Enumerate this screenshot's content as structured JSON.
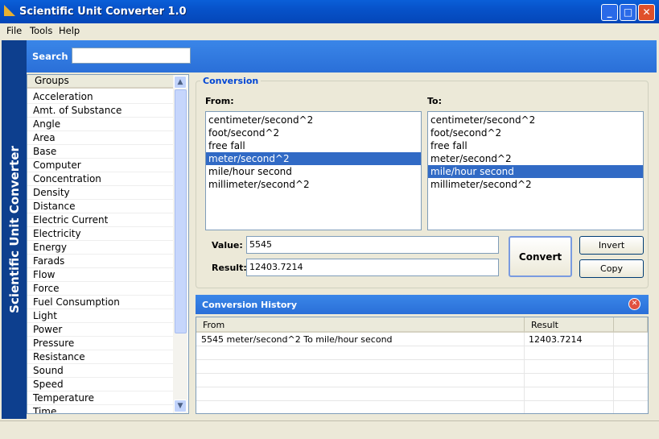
{
  "window": {
    "title": "Scientific Unit Converter 1.0",
    "controls": [
      "minimize",
      "maximize",
      "close"
    ]
  },
  "menu": [
    "File",
    "Tools",
    "Help"
  ],
  "sidebar_title": "Scientific Unit Converter",
  "search": {
    "label": "Search",
    "value": ""
  },
  "groups": {
    "header": "Groups",
    "items": [
      "Acceleration",
      "Amt. of Substance",
      "Angle",
      "Area",
      "Base",
      "Computer",
      "Concentration",
      "Density",
      "Distance",
      "Electric Current",
      "Electricity",
      "Energy",
      "Farads",
      "Flow",
      "Force",
      "Fuel Consumption",
      "Light",
      "Power",
      "Pressure",
      "Resistance",
      "Sound",
      "Speed",
      "Temperature",
      "Time"
    ]
  },
  "conversion": {
    "title": "Conversion",
    "from_label": "From:",
    "to_label": "To:",
    "units": [
      "centimeter/second^2",
      "foot/second^2",
      "free fall",
      "meter/second^2",
      "mile/hour second",
      "millimeter/second^2"
    ],
    "from_selected": "meter/second^2",
    "to_selected": "mile/hour second",
    "value_label": "Value:",
    "value": "5545",
    "result_label": "Result:",
    "result": "12403.7214",
    "convert": "Convert",
    "invert": "Invert",
    "copy": "Copy"
  },
  "history": {
    "title": "Conversion History",
    "columns": [
      "From",
      "Result"
    ],
    "rows": [
      {
        "from": "5545 meter/second^2 To mile/hour second",
        "result": "12403.7214"
      }
    ]
  },
  "colors": {
    "accent": "#2a6fd8",
    "selection": "#316ac5",
    "sidebar": "#0d3f8e"
  }
}
